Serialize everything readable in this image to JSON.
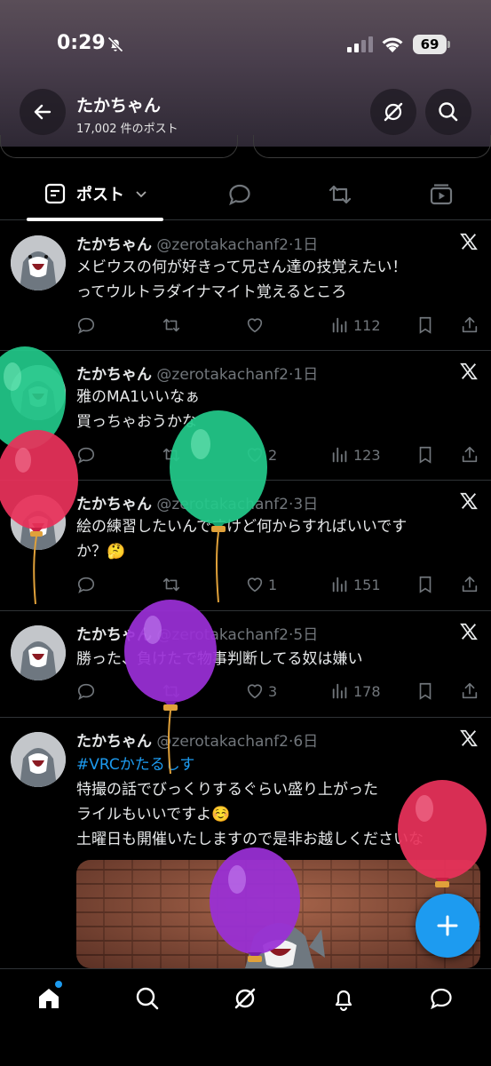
{
  "status_bar": {
    "time": "0:29",
    "battery": "69"
  },
  "header": {
    "name": "たかちゃん",
    "post_count": "17,002 件のポスト"
  },
  "tabs": {
    "posts_label": "ポスト"
  },
  "tweets": [
    {
      "name": "たかちゃん",
      "handle": "@zerotakachanf2",
      "time": "1日",
      "lines": [
        "メビウスの何が好きって兄さん達の技覚えたい！",
        "ってウルトラダイナマイト覚えるところ"
      ],
      "likes": "",
      "views": "112"
    },
    {
      "name": "たかちゃん",
      "handle": "@zerotakachanf2",
      "time": "1日",
      "lines": [
        "雅のMA1いいなぁ",
        "買っちゃおうかな"
      ],
      "likes": "2",
      "views": "123"
    },
    {
      "name": "たかちゃん",
      "handle": "@zerotakachanf2",
      "time": "3日",
      "lines": [
        "絵の練習したいんですけど何からすればいいです",
        "か？🤔"
      ],
      "likes": "1",
      "views": "151"
    },
    {
      "name": "たかちゃん",
      "handle": "@zerotakachanf2",
      "time": "5日",
      "lines": [
        "勝った、負けたで物事判断してる奴は嫌い"
      ],
      "likes": "3",
      "views": "178"
    },
    {
      "name": "たかちゃん",
      "handle": "@zerotakachanf2",
      "time": "6日",
      "hashtag": "#VRCかたるしす",
      "lines": [
        "特撮の話でびっくりするぐらい盛り上がった",
        "ライルもいいですよ☺️",
        "土曜日も開催いたしますので是非お越しくださいな"
      ]
    }
  ],
  "colors": {
    "accent": "#1d9bf0",
    "balloon_green": "#22c98a",
    "balloon_red": "#e8325a",
    "balloon_purple": "#9a2fd6"
  },
  "icons": {
    "back": "arrow-left-icon",
    "grok": "grok-icon",
    "search": "search-icon",
    "reply": "reply-icon",
    "retweet": "retweet-icon",
    "like": "heart-icon",
    "views": "views-icon",
    "bookmark": "bookmark-icon",
    "share": "share-icon",
    "compose": "plus-icon"
  }
}
